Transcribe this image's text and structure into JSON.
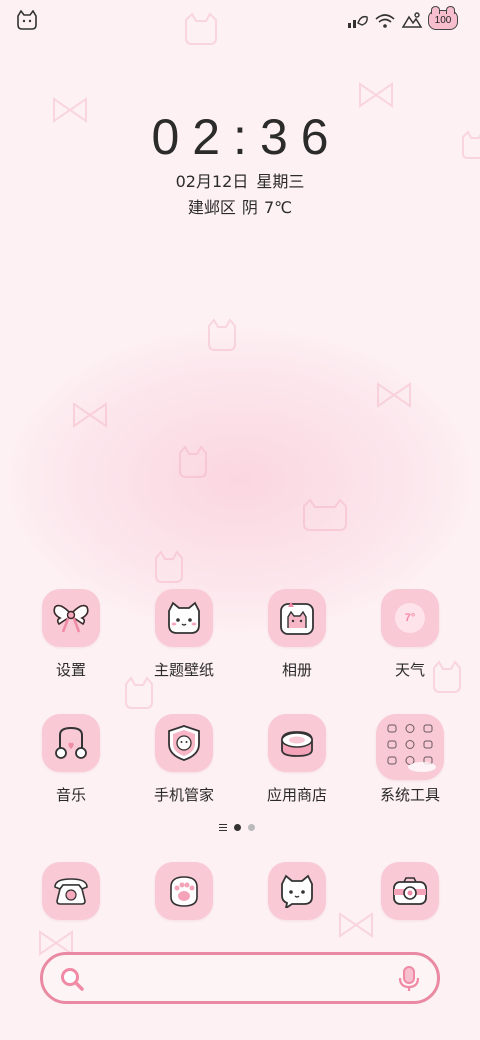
{
  "status_bar": {
    "left_icon": "cat-face-icon",
    "right_icons": [
      "signal-icon",
      "wifi-icon",
      "hotspot-icon"
    ],
    "battery_level": "100"
  },
  "clock": {
    "time": "02:36",
    "date": "02月12日",
    "weekday": "星期三",
    "location": "建邺区",
    "condition": "阴",
    "temperature": "7℃"
  },
  "apps": {
    "settings": {
      "label": "设置",
      "icon": "bow-icon"
    },
    "themes": {
      "label": "主题壁纸",
      "icon": "cat-face-icon"
    },
    "gallery": {
      "label": "相册",
      "icon": "photo-frame-icon"
    },
    "weather": {
      "label": "天气",
      "icon": "weather-icon",
      "badge": "7°"
    },
    "music": {
      "label": "音乐",
      "icon": "music-note-icon"
    },
    "phone_manager": {
      "label": "手机管家",
      "icon": "shield-icon"
    },
    "app_store": {
      "label": "应用商店",
      "icon": "cake-box-icon"
    },
    "system_tools": {
      "label": "系统工具",
      "icon": "folder-grid-icon"
    }
  },
  "dock": {
    "phone": {
      "icon": "telephone-icon"
    },
    "paw": {
      "icon": "paw-icon"
    },
    "messages": {
      "icon": "cat-chat-icon"
    },
    "camera": {
      "icon": "camera-icon"
    }
  },
  "search": {
    "placeholder": "",
    "left_icon": "search-icon",
    "right_icon": "microphone-icon"
  },
  "colors": {
    "background": "#fdf1f4",
    "icon_tile": "#f9c9d5",
    "accent": "#e98aa2"
  }
}
